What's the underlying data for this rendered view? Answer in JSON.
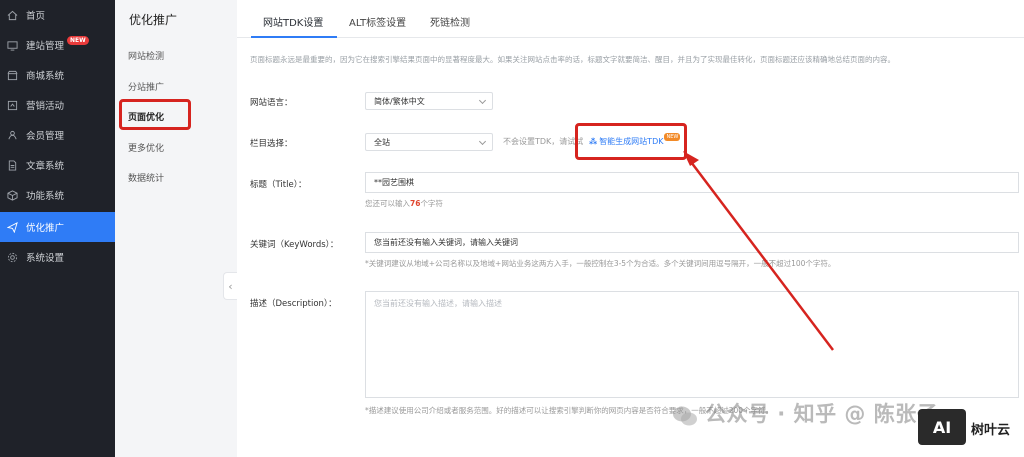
{
  "nav": {
    "items": [
      {
        "label": "首页",
        "icon": "home-icon"
      },
      {
        "label": "建站管理",
        "icon": "monitor-icon",
        "badge": "NEW"
      },
      {
        "label": "商城系统",
        "icon": "store-icon"
      },
      {
        "label": "营销活动",
        "icon": "campaign-icon"
      },
      {
        "label": "会员管理",
        "icon": "member-icon"
      },
      {
        "label": "文章系统",
        "icon": "document-icon"
      },
      {
        "label": "功能系统",
        "icon": "cube-icon"
      },
      {
        "label": "优化推广",
        "icon": "send-icon"
      },
      {
        "label": "系统设置",
        "icon": "gear-icon"
      }
    ],
    "active_index": 7
  },
  "subnav": {
    "title": "优化推广",
    "items": [
      "网站检测",
      "分站推广",
      "页面优化",
      "更多优化",
      "数据统计"
    ],
    "active_index": 2
  },
  "tabs": [
    "网站TDK设置",
    "ALT标签设置",
    "死链检测"
  ],
  "notice": "页面标题永远是最重要的，因为它在搜索引擎结果页面中的显著程度最大。如果关注网站点击率的话，标题文字就要简洁、醒目，并且为了实现最佳转化，页面标题还应该精确地总结页面的内容。",
  "form": {
    "language_label": "网站语言：",
    "language_value": "简体/繁体中文",
    "column_label": "栏目选择：",
    "column_value": "全站",
    "column_note": "不会设置TDK，请试试",
    "tdk_link": "智能生成网站TDK",
    "tdk_badge": "NEW",
    "title_label": "标题（Title）：",
    "title_value": "**园艺围棋",
    "title_hint_prefix": "您还可以输入",
    "title_hint_count": "76",
    "title_hint_suffix": "个字符",
    "keywords_label": "关键词（KeyWords）：",
    "keywords_value": "您当前还没有输入关键词，请输入关键词",
    "keywords_hint": "*关键词建议从地域+公司名称以及地域+网站业务这两方入手，一般控制在3-5个为合适。多个关键词间用逗号隔开，一般不超过100个字符。",
    "description_label": "描述（Description）：",
    "description_placeholder": "您当前还没有输入描述，请输入描述",
    "description_hint": "*描述建议使用公司介绍或者服务范围。好的描述可以让搜索引擎判断你的网页内容是否符合要求，一般不超过200个字符。"
  },
  "watermark": {
    "text": "公众号 · 知乎 @ 陈张子",
    "brand_box": "AI",
    "brand_name": "树叶云"
  },
  "colors": {
    "nav_bg": "#1f2229",
    "accent": "#2f7cf6",
    "highlight": "#d6241f"
  }
}
